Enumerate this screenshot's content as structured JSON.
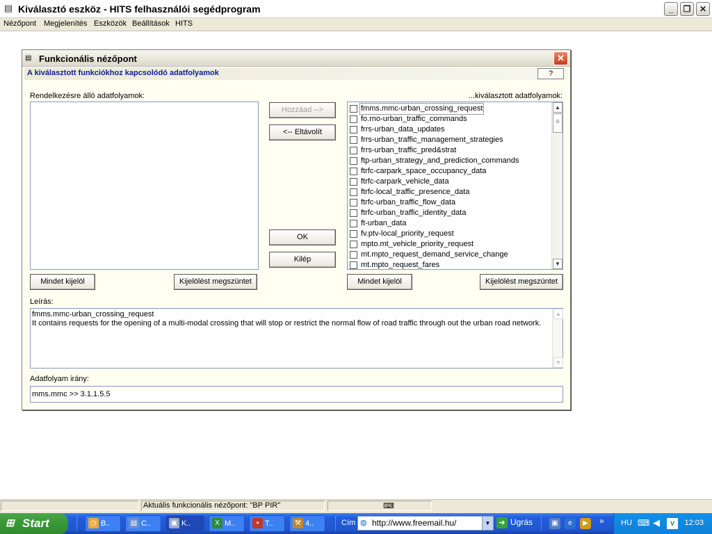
{
  "window": {
    "title": "Kiválasztó eszköz - HITS felhasználói segédprogram",
    "controls": {
      "minimize": "_",
      "maximize": "❐",
      "close": "✕"
    }
  },
  "menu": [
    "Nézőpont",
    "Megjelenítés",
    "Eszközök",
    "Beállítások",
    "HITS"
  ],
  "dialog": {
    "title": "Funkcionális nézőpont",
    "subheader": "A kiválasztott funkciókhoz kapcsolódó adatfolyamok",
    "help_label": "?",
    "available_label": "Rendelkezésre álló adatfolyamok:",
    "selected_label": "...kiválasztott adatfolyamok:",
    "buttons": {
      "add": "Hozzáad -->",
      "remove": "<-- Eltávolít",
      "ok": "OK",
      "exit": "Kilép",
      "select_all_left": "Mindet kijelöl",
      "deselect_left": "Kijelölést megszüntet",
      "select_all_right": "Mindet kijelöl",
      "deselect_right": "Kijelölést megszüntet"
    },
    "selected_items": [
      "fmms.mmc-urban_crossing_request",
      "fo.rno-urban_traffic_commands",
      "frrs-urban_data_updates",
      "frrs-urban_traffic_management_strategies",
      "frrs-urban_traffic_pred&strat",
      "ftp-urban_strategy_and_prediction_commands",
      "ftrfc-carpark_space_occupancy_data",
      "ftrfc-carpark_vehicle_data",
      "ftrfc-local_traffic_presence_data",
      "ftrfc-urban_traffic_flow_data",
      "ftrfc-urban_traffic_identity_data",
      "ft-urban_data",
      "fv.ptv-local_priority_request",
      "mpto.mt_vehicle_priority_request",
      "mt.mpto_request_demand_service_change",
      "mt.mpto_request_fares"
    ],
    "description_label": "Leírás:",
    "description_line1": "fmms.mmc-urban_crossing_request",
    "description_line2": "It contains requests for the opening of a multi-modal crossing that will stop or restrict the normal flow of road traffic through out the urban road network.",
    "direction_label": "Adatfolyam irány:",
    "direction_value": "mms.mmc >> 3.1.1.5.5"
  },
  "status": {
    "viewpoint": "Aktuális funkcionális nézőpont: \"BP PIR\""
  },
  "taskbar": {
    "start": "Start",
    "buttons": [
      {
        "label": "B..",
        "icon": "clock-icon"
      },
      {
        "label": "C..",
        "icon": "document-icon"
      },
      {
        "label": "K..",
        "icon": "app-icon",
        "active": true
      },
      {
        "label": "M..",
        "icon": "excel-icon"
      },
      {
        "label": "T..",
        "icon": "save-icon"
      },
      {
        "label": "4..",
        "icon": "tool-icon"
      }
    ],
    "address_label": "Cím",
    "address_value": "http://www.freemail.hu/",
    "go_label": "Ugrás",
    "lang": "HU",
    "clock": "12:03"
  },
  "colors": {
    "dialog_bg": "#fffff2",
    "subheader_text": "#0a1f8f",
    "taskbar": "#245edb",
    "start": "#3c9a3a"
  }
}
